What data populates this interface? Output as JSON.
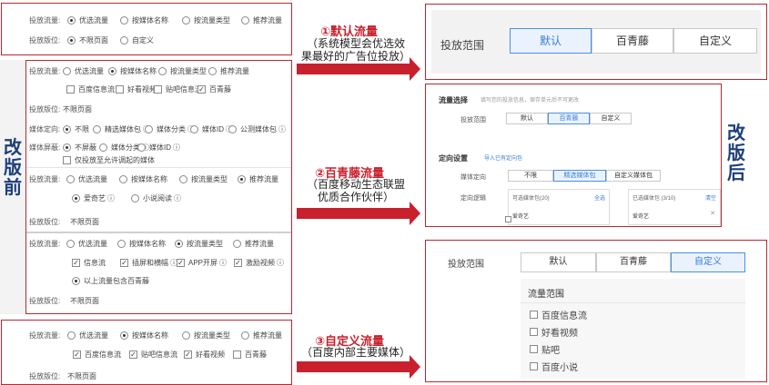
{
  "old": {
    "labels": {
      "traffic": "投放流量:",
      "placement": "投放版位:",
      "media_target": "媒体定向:",
      "media_block": "媒体屏蔽:"
    },
    "options": {
      "preferred": "优选流量",
      "by_media": "按媒体名称",
      "by_type": "按流量类型",
      "recommended": "推荐流量"
    },
    "no_limit_page": "不限页面",
    "custom": "自定义",
    "panel2": {
      "checks": [
        "百度信息流",
        "好看视频",
        "贴吧信息流",
        "百青藤"
      ],
      "target_options": [
        "不限",
        "精选媒体包",
        "媒体分类",
        "媒体ID",
        "公测媒体包"
      ],
      "block_options": [
        "不屏蔽",
        "媒体分类",
        "媒体ID"
      ],
      "block_check": "仅投放至允许调起的媒体"
    },
    "panel3": {
      "items": [
        "爱奇艺",
        "小说阅读"
      ]
    },
    "panel4": {
      "checks": [
        "信息流",
        "插屏和横幅",
        "APP开屏",
        "激励视频"
      ],
      "extra": "以上流量包含百青藤"
    },
    "panel5": {
      "checks": [
        "百度信息流",
        "贴吧信息流",
        "好看视频",
        "百青藤"
      ]
    }
  },
  "side_left": "改版前",
  "side_right": "改版后",
  "callouts": [
    {
      "title": "①默认流量",
      "sub1": "（系统模型会优选效",
      "sub2": "果最好的广告位投放）"
    },
    {
      "title": "②百青藤流量",
      "sub1": "（百度移动生态联盟",
      "sub2": "优质合作伙伴）"
    },
    {
      "title": "③自定义流量",
      "sub1": "（百度内部主要媒体）",
      "sub2": ""
    }
  ],
  "new": {
    "scope_label": "投放范围",
    "tabs": [
      "默认",
      "百青藤",
      "自定义"
    ],
    "p2": {
      "section1": "流量选择",
      "hint": "填写您的投放信息，保存单元后不可更改",
      "scope": "投放范围",
      "section2": "定向设置",
      "import": "导入已有定向包",
      "media_target": "媒体定向",
      "target_tabs": [
        "不限",
        "精选媒体包",
        "自定义媒体包"
      ],
      "logic": "定向逻辑",
      "available": "可选媒体包(20)",
      "select_all": "全选",
      "selected": "已选媒体包 (3/10)",
      "clear": "清空",
      "item": "爱奇艺"
    },
    "p3": {
      "title": "流量范围",
      "items": [
        "百度信息流",
        "好看视频",
        "贴吧",
        "百度小说"
      ]
    }
  }
}
